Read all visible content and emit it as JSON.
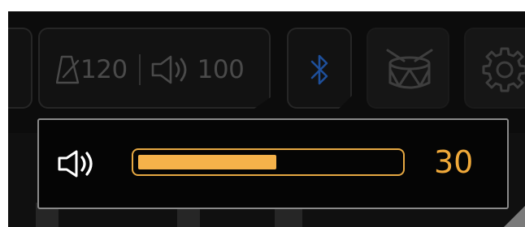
{
  "toolbar": {
    "tempo_icon": "metronome-icon",
    "tempo_value": "120",
    "volume_icon": "speaker-icon",
    "volume_value": "100",
    "bluetooth_icon": "bluetooth-icon",
    "drum_icon": "drum-icon",
    "settings_icon": "gear-icon"
  },
  "volume_popup": {
    "icon": "speaker-icon",
    "value": "30",
    "level_fraction": 0.53
  },
  "colors": {
    "accent": "#f5b24a",
    "bluetooth": "#1e4f9a",
    "muted_text": "#4a4a4a"
  }
}
